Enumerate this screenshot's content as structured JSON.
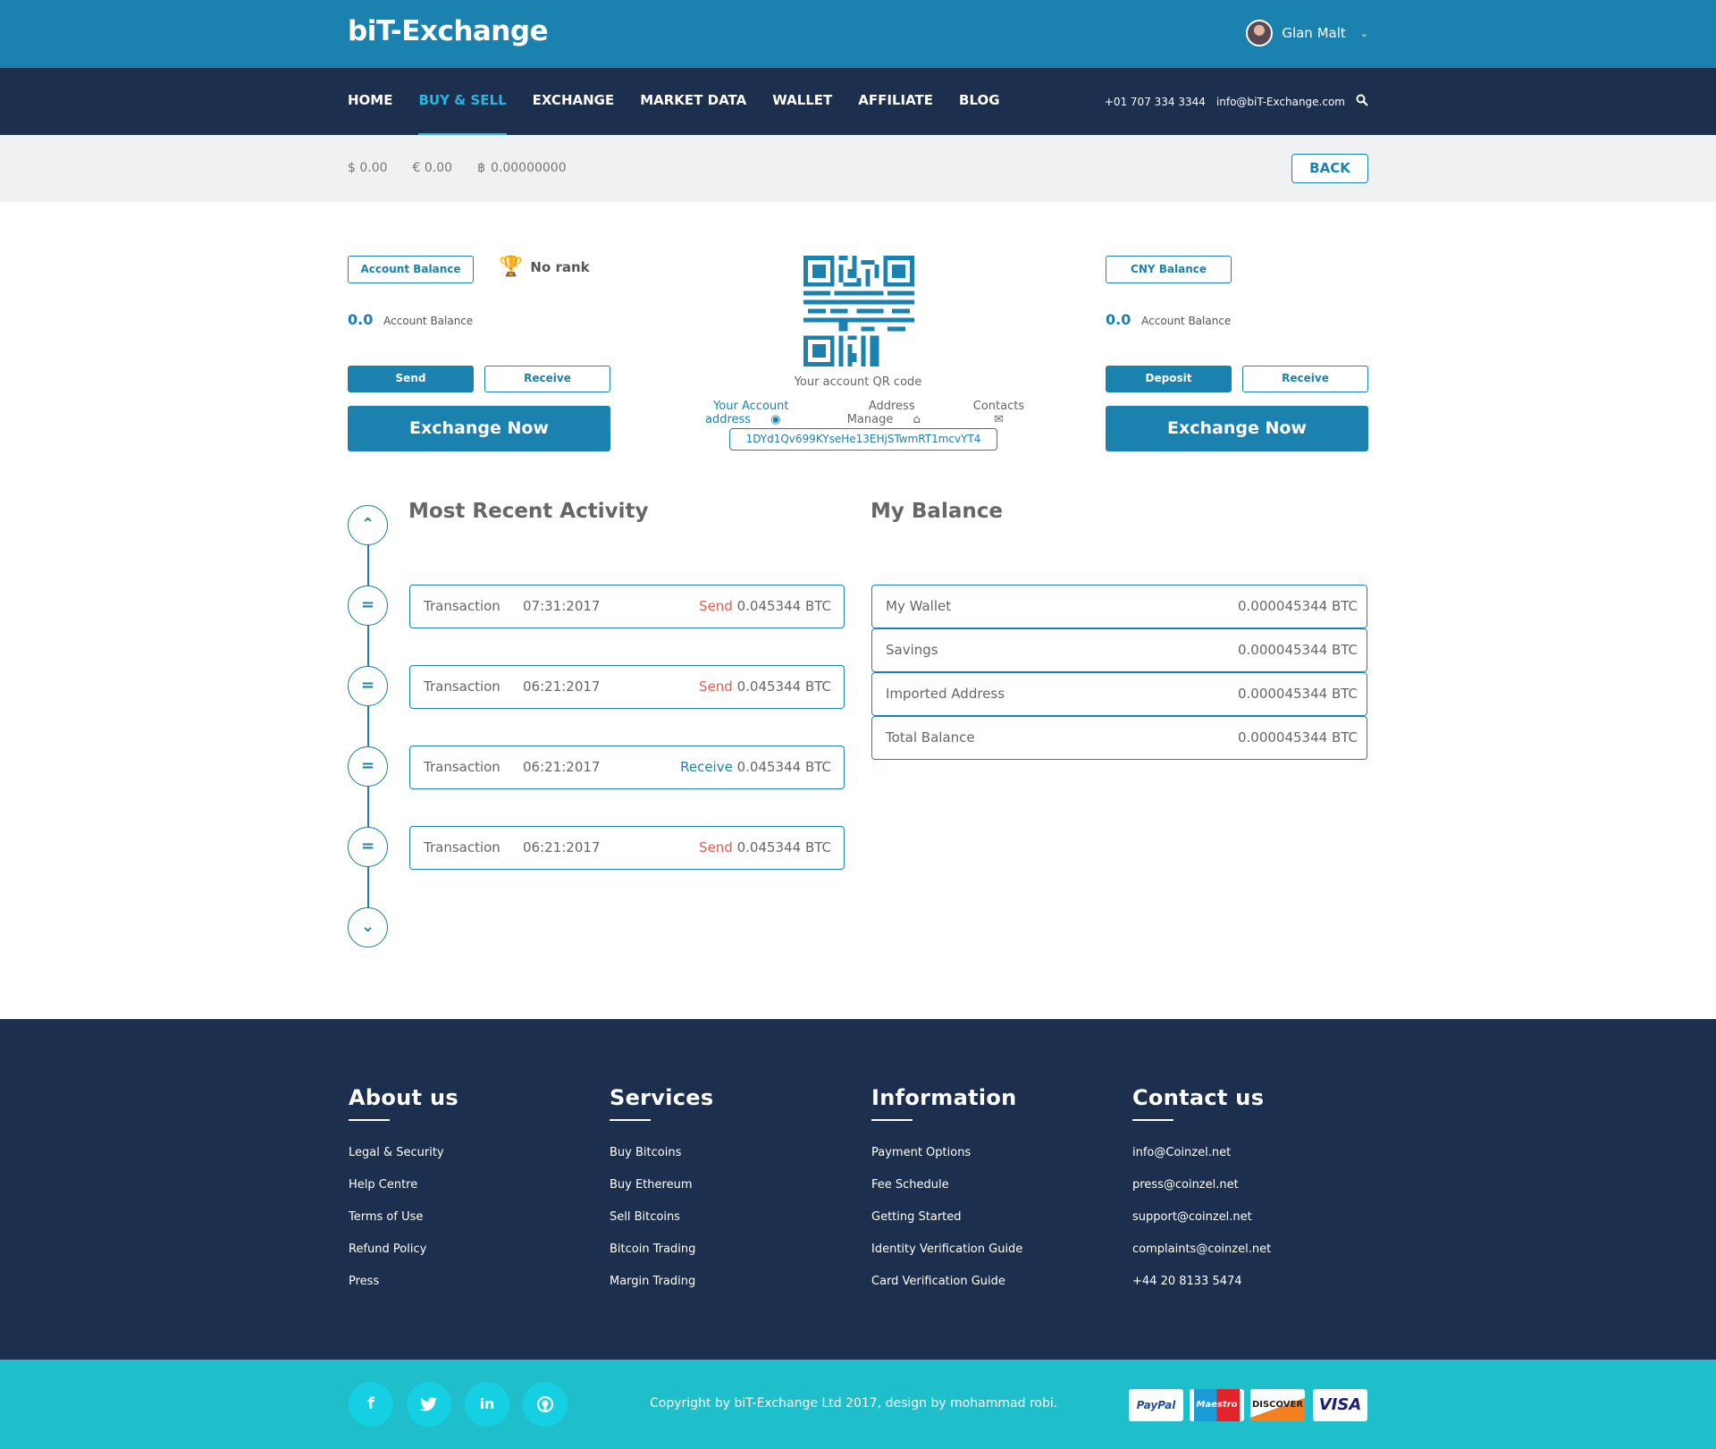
{
  "header": {
    "logo": "biT-Exchange",
    "user_name": "Glan Malt"
  },
  "nav": {
    "items": [
      {
        "label": "HOME"
      },
      {
        "label": "BUY & SELL"
      },
      {
        "label": "EXCHANGE"
      },
      {
        "label": "MARKET DATA"
      },
      {
        "label": "WALLET"
      },
      {
        "label": "AFFILIATE"
      },
      {
        "label": "BLOG"
      }
    ],
    "active_index": 1,
    "phone": "+01 707 334 3344",
    "email": "info@biT-Exchange.com"
  },
  "subbar": {
    "usd": "$ 0.00",
    "eur": "€  0.00",
    "btc": "0.00000000",
    "back_label": "BACK"
  },
  "left_card": {
    "badge": "Account Balance",
    "rank": "No rank",
    "balance_value": "0.0",
    "balance_label": "Account Balance",
    "send_label": "Send",
    "receive_label": "Receive",
    "exchange_label": "Exchange Now"
  },
  "center": {
    "qr_caption": "Your account QR code",
    "address_link": "Your Account address",
    "address_manage": "Address Manage",
    "contacts": "Contacts",
    "address": "1DYd1Qv699KYseHe13EHjSTwmRT1mcvYT4"
  },
  "right_card": {
    "badge": "CNY Balance",
    "balance_value": "0.0",
    "balance_label": "Account Balance",
    "deposit_label": "Deposit",
    "receive_label": "Receive",
    "exchange_label": "Exchange Now"
  },
  "activity": {
    "title": "Most Recent Activity",
    "rows": [
      {
        "label": "Transaction",
        "date": "07:31:2017",
        "type": "Send",
        "amount": "0.045344 BTC"
      },
      {
        "label": "Transaction",
        "date": "06:21:2017",
        "type": "Send",
        "amount": "0.045344 BTC"
      },
      {
        "label": "Transaction",
        "date": "06:21:2017",
        "type": "Receive",
        "amount": "0.045344 BTC"
      },
      {
        "label": "Transaction",
        "date": "06:21:2017",
        "type": "Send",
        "amount": "0.045344 BTC"
      }
    ]
  },
  "my_balance": {
    "title": "My Balance",
    "rows": [
      {
        "label": "My Wallet",
        "value": "0.000045344 BTC"
      },
      {
        "label": "Savings",
        "value": "0.000045344 BTC"
      },
      {
        "label": "Imported Address",
        "value": "0.000045344 BTC"
      },
      {
        "label": "Total Balance",
        "value": "0.000045344 BTC"
      }
    ]
  },
  "footer": {
    "about": {
      "title": "About us",
      "links": [
        "Legal & Security",
        "Help Centre",
        "Terms of Use",
        "Refund Policy",
        "Press"
      ]
    },
    "services": {
      "title": "Services",
      "links": [
        "Buy Bitcoins",
        "Buy Ethereum",
        "Sell Bitcoins",
        "Bitcoin Trading",
        "Margin Trading"
      ]
    },
    "information": {
      "title": "Information",
      "links": [
        "Payment Options",
        "Fee Schedule",
        "Getting Started",
        "Identity Verification Guide",
        "Card Verification Guide"
      ]
    },
    "contact": {
      "title": "Contact us",
      "links": [
        "info@Coinzel.net",
        "press@coinzel.net",
        "support@coinzel.net",
        "complaints@coinzel.net",
        "+44 20 8133 5474"
      ]
    }
  },
  "bottom": {
    "copyright": "Copyright by biT-Exchange Ltd 2017, design by mohammad robi.",
    "payments": [
      "PayPal",
      "Maestro",
      "DISCOVER",
      "VISA"
    ]
  },
  "colors": {
    "primary": "#1b82b0",
    "navy": "#1d2f4e",
    "teal": "#1fbecb",
    "send": "#e85c4e"
  }
}
